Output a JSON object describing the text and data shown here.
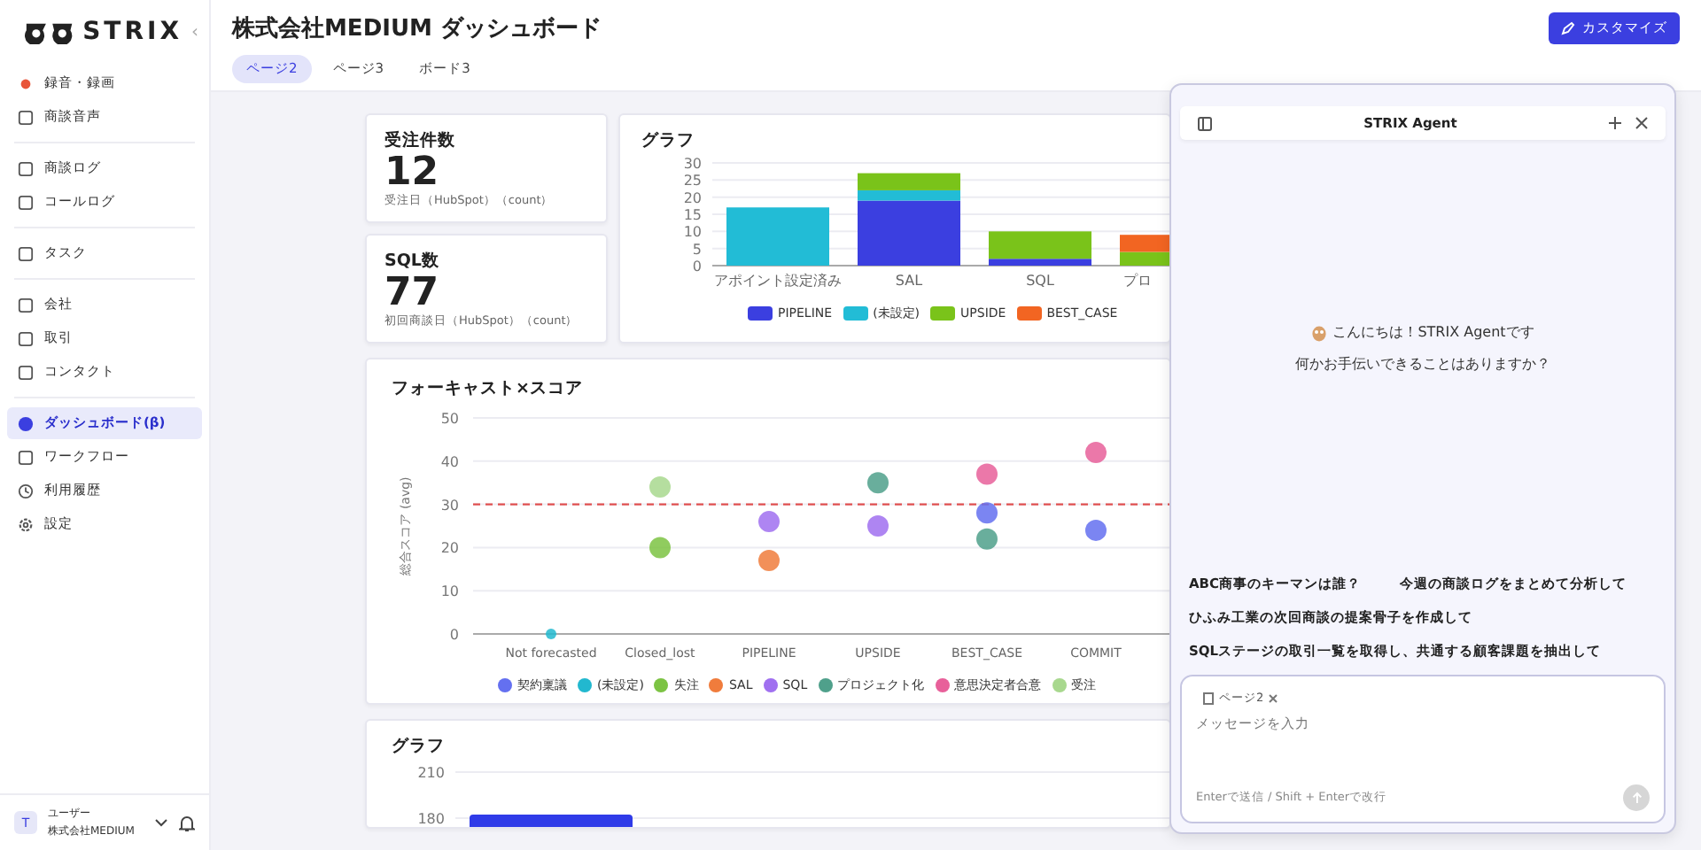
{
  "brand": {
    "name": "STRIX",
    "collapse": "‹"
  },
  "header": {
    "title": "株式会社MEDIUM ダッシュボード",
    "button": "カスタマイズ"
  },
  "tabs": [
    {
      "label": "ページ2",
      "selected": true
    },
    {
      "label": "ページ3",
      "selected": false
    },
    {
      "label": "ボード3",
      "selected": false
    }
  ],
  "sidebar": {
    "groups": [
      [
        {
          "label": "録音・録画",
          "selected": false
        },
        {
          "label": "商談音声",
          "selected": false
        }
      ],
      [
        {
          "label": "商談ログ",
          "selected": false
        },
        {
          "label": "コールログ",
          "selected": false
        }
      ],
      [
        {
          "label": "タスク",
          "selected": false
        }
      ],
      [
        {
          "label": "会社",
          "selected": false
        },
        {
          "label": "取引",
          "selected": false
        },
        {
          "label": "コンタクト",
          "selected": false
        }
      ],
      [
        {
          "label": "ダッシュボード(β)",
          "selected": true
        },
        {
          "label": "ワークフロー",
          "selected": false
        },
        {
          "label": "利用履歴",
          "selected": false
        },
        {
          "label": "設定",
          "selected": false
        }
      ]
    ],
    "user": {
      "initial": "T",
      "name": "ユーザー",
      "company": "株式会社MEDIUM"
    }
  },
  "kpis": [
    {
      "title": "受注件数",
      "value": "12",
      "note": "受注日（HubSpot）（count）"
    },
    {
      "title": "SQL数",
      "value": "77",
      "note": "初回商談日（HubSpot）（count）"
    }
  ],
  "bar_card": {
    "title": "グラフ",
    "chart_data": {
      "type": "bar",
      "stacked": true,
      "categories": [
        "アポイント設定済み",
        "SAL",
        "SQL",
        "プロ"
      ],
      "yticks": [
        0,
        5,
        10,
        15,
        20,
        25,
        30
      ],
      "ylim": [
        0,
        30
      ],
      "grid": true,
      "series": [
        {
          "name": "PIPELINE",
          "color": "#3b3fe0",
          "values": [
            0,
            19,
            2,
            0
          ]
        },
        {
          "name": "(未設定)",
          "color": "#22bcd6",
          "values": [
            17,
            3,
            0,
            0
          ]
        },
        {
          "name": "UPSIDE",
          "color": "#7ac31a",
          "values": [
            0,
            5,
            8,
            4
          ]
        },
        {
          "name": "BEST_CASE",
          "color": "#f26522",
          "values": [
            0,
            0,
            0,
            5
          ]
        }
      ]
    }
  },
  "scatter_card": {
    "title": "フォーキャスト×スコア",
    "chart_data": {
      "type": "scatter",
      "ylabel": "総合スコア (avg)",
      "categories": [
        "Not forecasted",
        "Closed_lost",
        "PIPELINE",
        "UPSIDE",
        "BEST_CASE",
        "COMMIT"
      ],
      "yticks": [
        0,
        10,
        20,
        30,
        40,
        50
      ],
      "ylim": [
        0,
        50
      ],
      "grid": true,
      "ref_lines": [
        {
          "axis": "y",
          "value": 30
        }
      ],
      "series": [
        {
          "name": "契約稟議",
          "color": "#6470f0",
          "values": [
            null,
            null,
            null,
            null,
            28,
            24
          ]
        },
        {
          "name": "(未設定)",
          "color": "#22b8cf",
          "values": [
            0,
            null,
            null,
            null,
            null,
            null
          ]
        },
        {
          "name": "失注",
          "color": "#7cc343",
          "values": [
            null,
            20,
            null,
            null,
            null,
            null
          ]
        },
        {
          "name": "SAL",
          "color": "#f07c3c",
          "values": [
            null,
            null,
            17,
            null,
            null,
            null
          ]
        },
        {
          "name": "SQL",
          "color": "#a070f0",
          "values": [
            null,
            null,
            26,
            25,
            null,
            null
          ]
        },
        {
          "name": "プロジェクト化",
          "color": "#4fa08b",
          "values": [
            null,
            null,
            null,
            35,
            22,
            null
          ]
        },
        {
          "name": "意思決定者合意",
          "color": "#e8609a",
          "values": [
            null,
            null,
            null,
            null,
            37,
            42
          ]
        },
        {
          "name": "受注",
          "color": "#a8d88e",
          "values": [
            null,
            34,
            null,
            null,
            null,
            null
          ]
        }
      ]
    }
  },
  "bottom_card": {
    "title": "グラフ",
    "axis_labels": [
      "210",
      "180"
    ]
  },
  "agent": {
    "title": "STRIX Agent",
    "greeting": "こんにちは！STRIX Agentです",
    "question": "何かお手伝いできることはありますか？",
    "suggestions": [
      [
        "ABC商事のキーマンは誰？",
        "今週の商談ログをまとめて分析して"
      ],
      [
        "ひふみ工業の次回商談の提案骨子を作成して"
      ],
      [
        "SQLステージの取引一覧を取得し、共通する顧客課題を抽出して"
      ]
    ],
    "chip": "ページ2",
    "placeholder": "メッセージを入力",
    "hint": "Enterで送信 / Shift + Enterで改行"
  }
}
